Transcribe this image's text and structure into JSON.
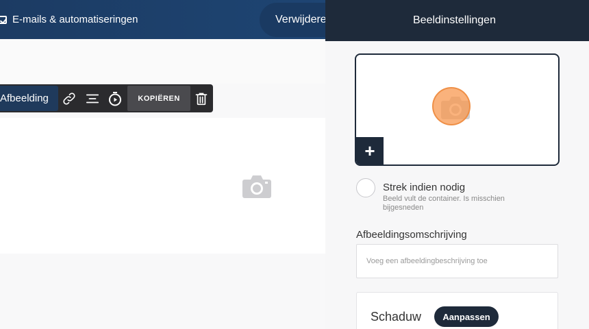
{
  "topbar": {
    "emails_link": "E-mails & automatiseringen",
    "delete_button": "Verwijderen"
  },
  "toolbar": {
    "image_label": "Afbeelding",
    "copy_label": "KOPIËREN",
    "icons": [
      "link-icon",
      "align-icon",
      "timer-icon",
      "trash-icon"
    ]
  },
  "panel": {
    "title": "Beeldinstellingen",
    "add_label": "+",
    "stretch": {
      "title": "Strek indien nodig",
      "description": "Beeld vult de container. Is misschien bijgesneden",
      "checked": false
    },
    "image_description": {
      "label": "Afbeeldingsomschrijving",
      "value": "",
      "placeholder": "Voeg een afbeeldingbeschrijving toe"
    },
    "shadow": {
      "label": "Schaduw",
      "button": "Aanpassen"
    }
  },
  "colors": {
    "topbar": "#1c3b63",
    "panel_header": "#1e2a3a",
    "toolbar": "#2b2b2e",
    "highlight": "#f89850"
  }
}
